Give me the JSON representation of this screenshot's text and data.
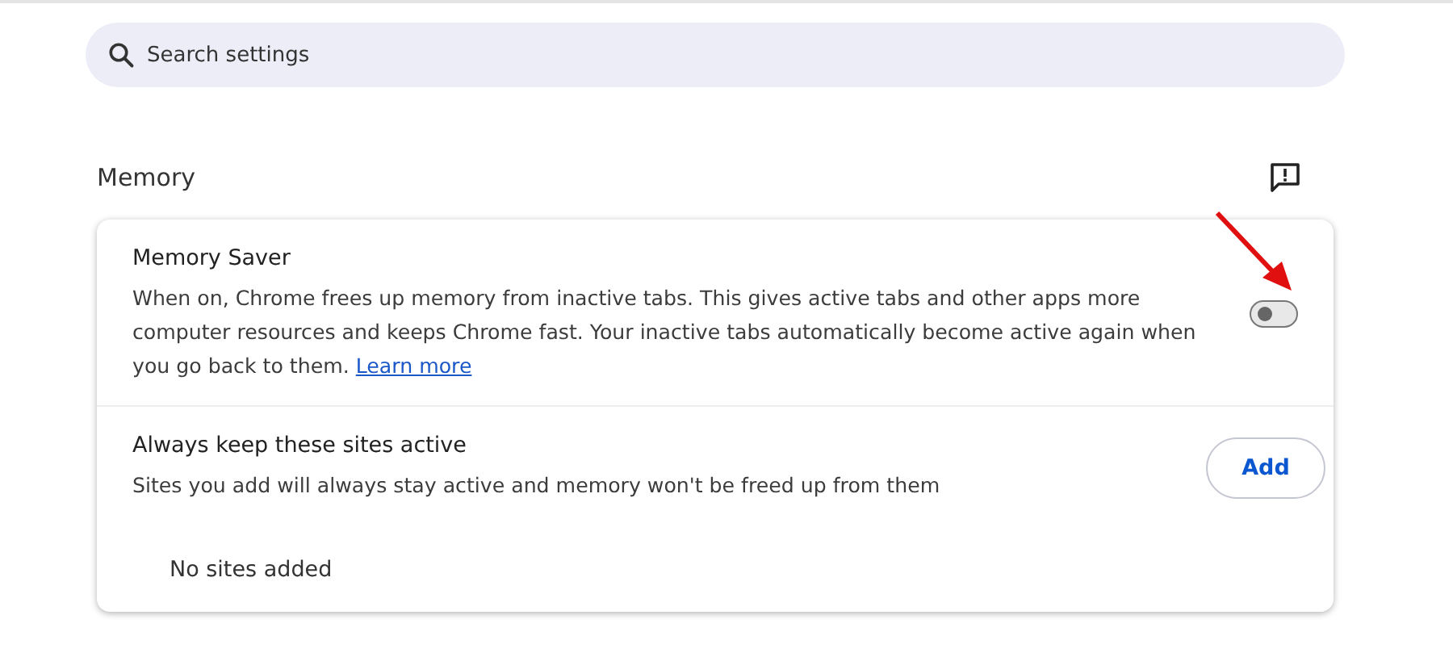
{
  "search": {
    "placeholder": "Search settings"
  },
  "section": {
    "title": "Memory"
  },
  "memory_saver": {
    "title": "Memory Saver",
    "description": "When on, Chrome frees up memory from inactive tabs. This gives active tabs and other apps more computer resources and keeps Chrome fast. Your inactive tabs automatically become active again when you go back to them.",
    "link": "Learn more",
    "on": false
  },
  "active_sites": {
    "title": "Always keep these sites active",
    "description": "Sites you add will always stay active and memory won't be freed up from them",
    "button": "Add",
    "empty": "No sites added"
  }
}
